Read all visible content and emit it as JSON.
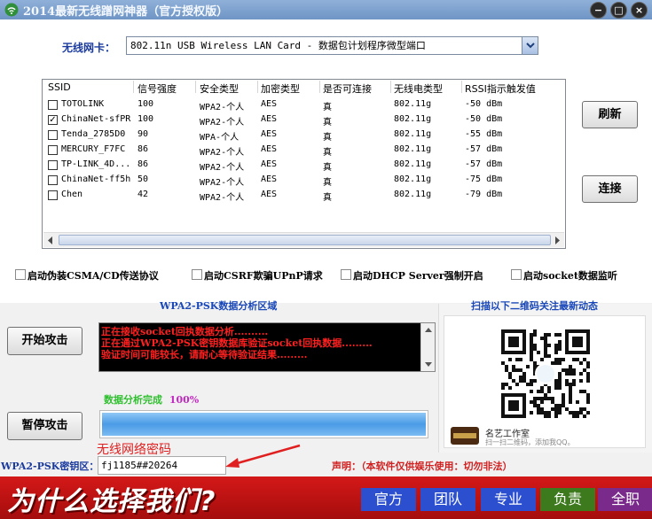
{
  "window": {
    "title": "2014最新无线蹭网神器（官方授权版）",
    "min_label": "−",
    "max_label": "□",
    "close_label": "×"
  },
  "adapter": {
    "label": "无线网卡：",
    "value": "802.11n USB Wireless LAN Card - 数据包计划程序微型端口"
  },
  "table": {
    "headers": [
      "SSID",
      "信号强度",
      "安全类型",
      "加密类型",
      "是否可连接",
      "无线电类型",
      "RSSI指示触发值"
    ],
    "rows": [
      {
        "checked": false,
        "ssid": "TOTOLINK",
        "signal": "100",
        "security": "WPA2-个人",
        "encryption": "AES",
        "connectable": "真",
        "radio": "802.11g",
        "rssi": "-50 dBm"
      },
      {
        "checked": true,
        "ssid": "ChinaNet-sfPR",
        "signal": "100",
        "security": "WPA2-个人",
        "encryption": "AES",
        "connectable": "真",
        "radio": "802.11g",
        "rssi": "-50 dBm"
      },
      {
        "checked": false,
        "ssid": "Tenda_2785D0",
        "signal": "90",
        "security": "WPA-个人",
        "encryption": "AES",
        "connectable": "真",
        "radio": "802.11g",
        "rssi": "-55 dBm"
      },
      {
        "checked": false,
        "ssid": "MERCURY_F7FC",
        "signal": "86",
        "security": "WPA2-个人",
        "encryption": "AES",
        "connectable": "真",
        "radio": "802.11g",
        "rssi": "-57 dBm"
      },
      {
        "checked": false,
        "ssid": "TP-LINK_4D...",
        "signal": "86",
        "security": "WPA2-个人",
        "encryption": "AES",
        "connectable": "真",
        "radio": "802.11g",
        "rssi": "-57 dBm"
      },
      {
        "checked": false,
        "ssid": "ChinaNet-ff5h",
        "signal": "50",
        "security": "WPA2-个人",
        "encryption": "AES",
        "connectable": "真",
        "radio": "802.11g",
        "rssi": "-75 dBm"
      },
      {
        "checked": false,
        "ssid": "Chen",
        "signal": "42",
        "security": "WPA2-个人",
        "encryption": "AES",
        "connectable": "真",
        "radio": "802.11g",
        "rssi": "-79 dBm"
      }
    ],
    "check_mark": "✓"
  },
  "buttons": {
    "refresh": "刷新",
    "connect": "连接",
    "start_attack": "开始攻击",
    "pause_attack": "暂停攻击"
  },
  "options": [
    "启动伪装CSMA/CD传送协议",
    "启动CSRF欺骗UPnP请求",
    "启动DHCP Server强制开启",
    "启动socket数据监听"
  ],
  "analysis": {
    "title": "WPA2-PSK数据分析区域",
    "log": [
      "正在接收socket回执数据分析..........",
      "正在通过WPA2-PSK密钥数据库验证socket回执数据.........",
      "验证时间可能较长，请耐心等待验证结果........."
    ],
    "status_text": "数据分析完成",
    "progress_label": "100%",
    "progress": 1.0
  },
  "qr": {
    "title": "扫描以下二维码关注最新动态",
    "account_name": "名艺工作室",
    "account_sub": "扫一扫二维码，添加我QQ。"
  },
  "password": {
    "label": "WPA2-PSK密钥区：",
    "value": "fj1185##20264",
    "annotation": "无线网络密码"
  },
  "disclaimer": "声明：（本软件仅供娱乐使用：切勿非法）",
  "banner": {
    "slogan": "为什么选择我们?",
    "nav": [
      {
        "label": "官方",
        "color": "#2b4fcf"
      },
      {
        "label": "团队",
        "color": "#2b4fcf"
      },
      {
        "label": "专业",
        "color": "#2b4fcf"
      },
      {
        "label": "负责",
        "color": "#3d7a1e"
      },
      {
        "label": "全职",
        "color": "#7a2a8a"
      }
    ]
  },
  "colors": {
    "accent_blue": "#1a48b8",
    "log_red": "#ff2020",
    "banner_red": "#c41414",
    "success_green": "#2fbf2f"
  }
}
